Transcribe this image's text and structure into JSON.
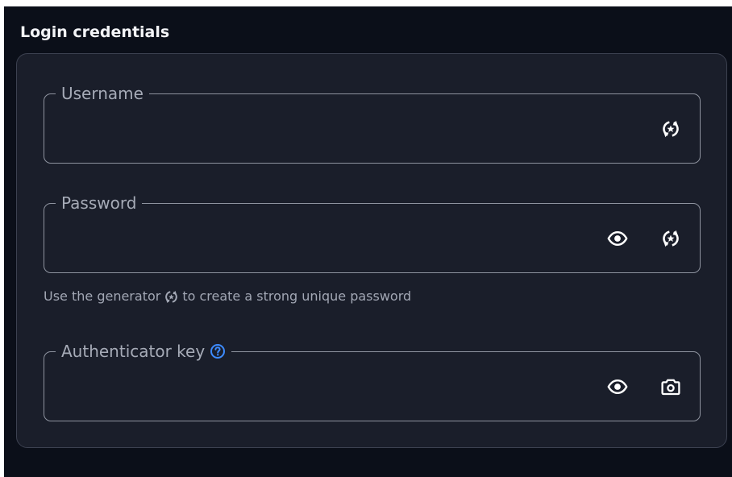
{
  "section": {
    "title": "Login credentials"
  },
  "fields": {
    "username": {
      "label": "Username",
      "value": "",
      "icons": [
        "generate-icon"
      ]
    },
    "password": {
      "label": "Password",
      "value": "",
      "icons": [
        "eye-icon",
        "generate-icon"
      ]
    },
    "authenticator": {
      "label": "Authenticator key",
      "value": "",
      "icons": [
        "help-circle-icon",
        "eye-icon",
        "camera-icon"
      ]
    }
  },
  "hint": {
    "before": "Use the generator",
    "after": "to create a strong unique password",
    "icon": "generate-icon"
  },
  "colors": {
    "background": "#0b0f19",
    "card": "#1a1e2a",
    "border": "#8e939f",
    "text": "#f3f4f7",
    "label": "#a6abb7",
    "accent": "#3d8bff"
  }
}
